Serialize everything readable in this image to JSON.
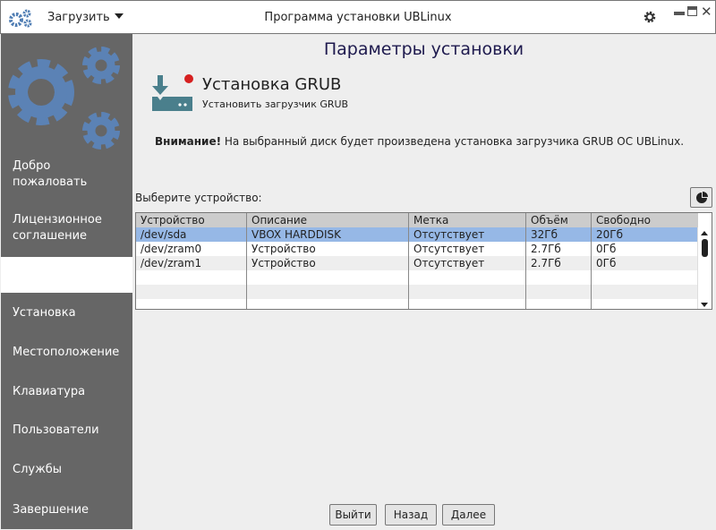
{
  "window": {
    "title": "Программа установки UBLinux",
    "menu_label": "Загрузить"
  },
  "sidebar": {
    "items": [
      {
        "label": "Добро пожаловать"
      },
      {
        "label": "Лицензионное соглашение"
      },
      {
        "label": ""
      },
      {
        "label": "Установка"
      },
      {
        "label": "Местоположение"
      },
      {
        "label": "Клавиатура"
      },
      {
        "label": "Пользователи"
      },
      {
        "label": "Службы"
      },
      {
        "label": "Завершение"
      }
    ]
  },
  "main": {
    "title": "Параметры установки",
    "heading": "Установка GRUB",
    "subheading": "Установить загрузчик GRUB",
    "warning_bold": "Внимание!",
    "warning_text": " На выбранный диск будет произведена установка загрузчика GRUB ОС UBLinux.",
    "select_label": "Выберите устройство:"
  },
  "table": {
    "headers": [
      "Устройство",
      "Описание",
      "Метка",
      "Объём",
      "Свободно"
    ],
    "rows": [
      [
        "/dev/sda",
        "VBOX HARDDISK",
        "Отсутствует",
        "32Гб",
        "20Гб"
      ],
      [
        "/dev/zram0",
        "Устройство",
        "Отсутствует",
        "2.7Гб",
        "0Гб"
      ],
      [
        "/dev/zram1",
        "Устройство",
        "Отсутствует",
        "2.7Гб",
        "0Гб"
      ]
    ]
  },
  "buttons": {
    "quit": "Выйти",
    "back": "Назад",
    "next": "Далее"
  },
  "colors": {
    "accent": "#5b82b5",
    "selection": "#96b8e6",
    "sidebar": "#666666"
  }
}
